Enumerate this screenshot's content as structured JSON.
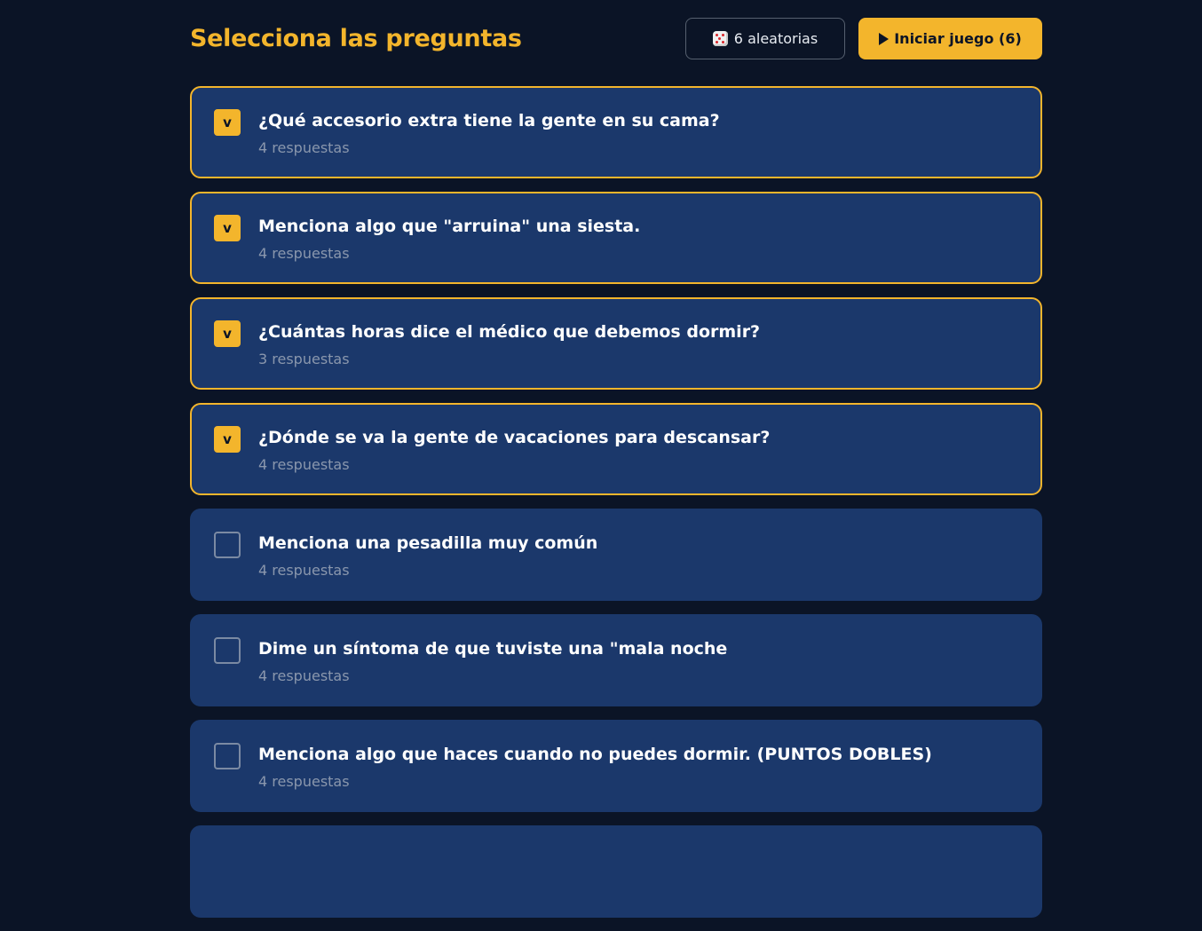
{
  "header": {
    "title": "Selecciona las preguntas",
    "random_button": "6 aleatorias",
    "start_button": "Iniciar juego (6)"
  },
  "colors": {
    "accent": "#f3b52c",
    "background": "#0b1426",
    "card": "#1b386b",
    "muted_text": "#8a97ad"
  },
  "check_glyph": "v",
  "questions": [
    {
      "text": "¿Qué accesorio extra tiene la gente en su cama?",
      "count": "4 respuestas",
      "selected": true
    },
    {
      "text": "Menciona algo que \"arruina\" una siesta.",
      "count": "4 respuestas",
      "selected": true
    },
    {
      "text": "¿Cuántas horas dice el médico que debemos dormir?",
      "count": "3 respuestas",
      "selected": true
    },
    {
      "text": "¿Dónde se va la gente de vacaciones para descansar?",
      "count": "4 respuestas",
      "selected": true
    },
    {
      "text": "Menciona una pesadilla muy común",
      "count": "4 respuestas",
      "selected": false
    },
    {
      "text": "Dime un síntoma de que tuviste una \"mala noche",
      "count": "4 respuestas",
      "selected": false
    },
    {
      "text": "Menciona algo que haces cuando no puedes dormir. (PUNTOS DOBLES)",
      "count": "4 respuestas",
      "selected": false
    }
  ]
}
